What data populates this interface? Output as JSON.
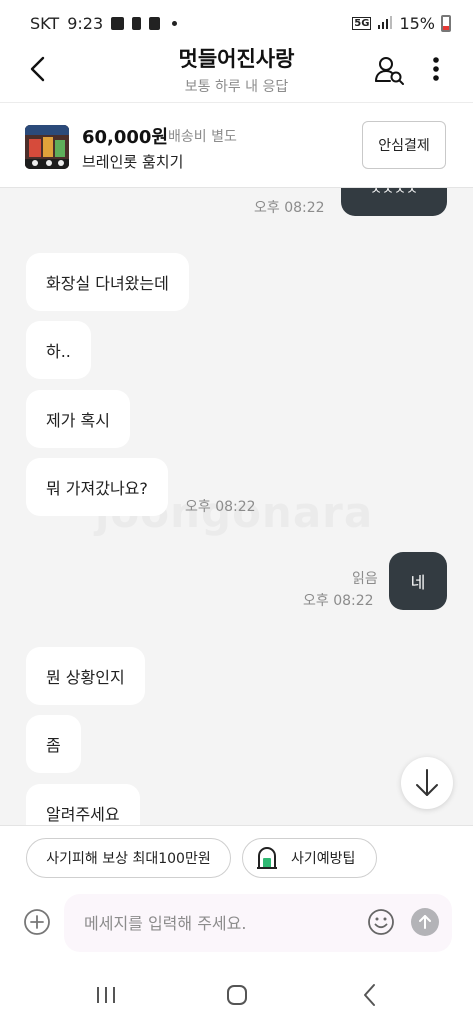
{
  "status_bar": {
    "carrier": "SKT",
    "time": "9:23",
    "network": "5G",
    "battery": "15%"
  },
  "header": {
    "title": "멋들어진사랑",
    "subtitle": "보통 하루 내 응답"
  },
  "product": {
    "price": "60,000원",
    "shipping": "배송비 별도",
    "name": "브레인롯 훔치기",
    "safe_pay_label": "안심결제"
  },
  "messages": {
    "top_partial": {
      "text": "ㅊㅊㅊㅊ",
      "time": "오후 08:22"
    },
    "incoming_1": [
      "화장실 다녀왔는데",
      "하..",
      "제가 혹시",
      "뭐 가져갔나요?"
    ],
    "incoming_1_time": "오후 08:22",
    "outgoing_1": {
      "text": "네",
      "read": "읽음",
      "time": "오후 08:22"
    },
    "incoming_2": [
      "뭔 상황인지",
      "좀",
      "알려주세요"
    ]
  },
  "watermark": "joongonara",
  "quick_actions": {
    "compensation": "사기피해 보상 최대100만원",
    "fraud_tips": "사기예방팁"
  },
  "composer": {
    "placeholder": "메세지를 입력해 주세요."
  },
  "colors": {
    "outgoing_bubble": "#333b41",
    "background": "#f4f4f4",
    "accent_green": "#2eb872"
  }
}
